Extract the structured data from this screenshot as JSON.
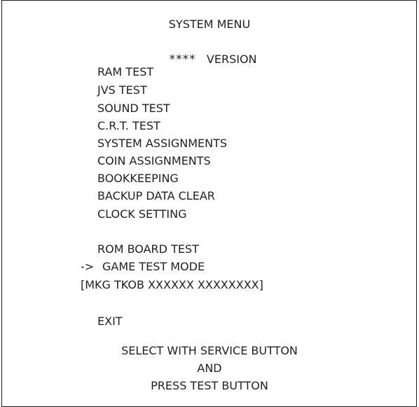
{
  "header": {
    "title": "SYSTEM MENU",
    "version_stars": "****",
    "version_label": "VERSION"
  },
  "menu": {
    "items": [
      {
        "label": "RAM TEST"
      },
      {
        "label": "JVS TEST"
      },
      {
        "label": "SOUND TEST"
      },
      {
        "label": "C.R.T. TEST"
      },
      {
        "label": "SYSTEM ASSIGNMENTS"
      },
      {
        "label": "COIN ASSIGNMENTS"
      },
      {
        "label": "BOOKKEEPING"
      },
      {
        "label": "BACKUP DATA CLEAR"
      },
      {
        "label": "CLOCK SETTING"
      }
    ],
    "rom_board_test": "ROM BOARD TEST",
    "cursor": "->",
    "game_test_mode": "GAME TEST MODE",
    "game_info": "[MKG TKOB XXXXXX XXXXXXXX]",
    "exit": "EXIT"
  },
  "footer": {
    "line1": "SELECT WITH SERVICE BUTTON",
    "line2": "AND",
    "line3": "PRESS TEST BUTTON"
  }
}
